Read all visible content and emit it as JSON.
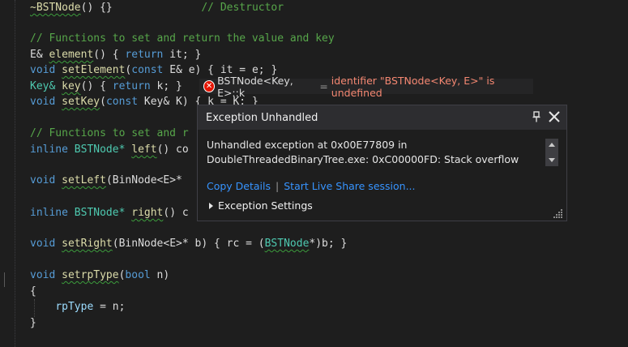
{
  "code": {
    "l1": {
      "fn": "~BSTNode",
      "rest": "() {}",
      "comment": "// Destructor"
    },
    "l2": {
      "comment": "// Functions to set and return the value and key"
    },
    "l3": {
      "type": "E&",
      "fn": "element",
      "pre": "() { ",
      "kw": "return",
      "post": " it; }"
    },
    "l4": {
      "kw": "void",
      "fn": "setElement",
      "pre": "(",
      "kw2": "const",
      "post": " E& e) { it = e; }"
    },
    "l5": {
      "type": "Key&",
      "fn": "key",
      "pre": "() { ",
      "kw": "return",
      "post": " k; }"
    },
    "l6": {
      "kw": "void",
      "fn": "setKey",
      "pre": "(",
      "kw2": "const",
      "post": " Key& K) { k = K; }"
    },
    "l7": {
      "comment": "// Functions to set and r"
    },
    "l8": {
      "kw": "inline",
      "type": "BSTNode*",
      "fn": "left",
      "post": "() co"
    },
    "l9": {
      "kw": "void",
      "fn": "setLeft",
      "post": "(BinNode<E>* "
    },
    "l10": {
      "kw": "inline",
      "type": "BSTNode*",
      "fn": "right",
      "post": "() c"
    },
    "l11": {
      "kw": "void",
      "fn": "setRight",
      "pre": "(BinNode<E>* b) { rc = (",
      "type": "BSTNode",
      "post": "*)b; }"
    },
    "l12": {
      "kw": "void",
      "fn": "setrpType",
      "pre": "(",
      "kw2": "bool",
      "post": " n)"
    },
    "l13": {
      "text": "{"
    },
    "l14": {
      "var": "rpType",
      "post": " = n;"
    },
    "l15": {
      "text": "}"
    }
  },
  "error_tip": {
    "icon": "error-icon",
    "symbol": "BSTNode<Key, E>::k",
    "eq": "=",
    "message": "identifier \"BSTNode<Key, E>\" is undefined"
  },
  "exception_popup": {
    "title": "Exception Unhandled",
    "message_line1": "Unhandled exception at 0x00E77809 in",
    "message_line2": "DoubleThreadedBinaryTree.exe: 0xC00000FD: Stack overflow",
    "copy_details": "Copy Details",
    "separator": "|",
    "live_share": "Start Live Share session...",
    "settings": "Exception Settings",
    "icons": [
      "pin-icon",
      "close-icon",
      "scroll-up-icon",
      "scroll-down-icon",
      "resize-grip-icon"
    ]
  },
  "colors": {
    "background": "#1e1e1e",
    "keyword": "#569cd6",
    "comment": "#57a64a",
    "type": "#4ec9b0",
    "function": "#dcdcaa",
    "link": "#3794ff",
    "error": "#f48771"
  }
}
